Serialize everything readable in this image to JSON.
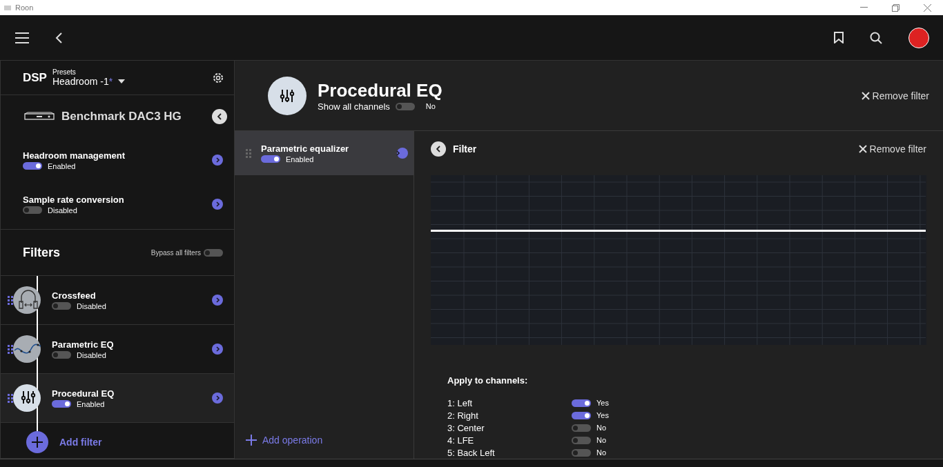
{
  "window": {
    "title": "Roon"
  },
  "dsp": {
    "title": "DSP",
    "presets_label": "Presets",
    "preset": "Headroom -1",
    "modified_mark": "*"
  },
  "device": {
    "name": "Benchmark DAC3 HG"
  },
  "settings": [
    {
      "title": "Headroom management",
      "enabled": true,
      "state": "Enabled"
    },
    {
      "title": "Sample rate conversion",
      "enabled": false,
      "state": "Disabled"
    }
  ],
  "filters": {
    "title": "Filters",
    "bypass_label": "Bypass all filters",
    "bypass": false,
    "items": [
      {
        "kind": "crossfeed",
        "name": "Crossfeed",
        "enabled": false,
        "state": "Disabled",
        "selected": false
      },
      {
        "kind": "parametric",
        "name": "Parametric EQ",
        "enabled": false,
        "state": "Disabled",
        "selected": false
      },
      {
        "kind": "procedural",
        "name": "Procedural EQ",
        "enabled": true,
        "state": "Enabled",
        "selected": true
      }
    ],
    "add_label": "Add filter"
  },
  "detail": {
    "title": "Procedural EQ",
    "show_all_label": "Show all channels",
    "show_all": false,
    "show_all_state": "No",
    "remove_label": "Remove filter"
  },
  "operations": {
    "items": [
      {
        "name": "Parametric equalizer",
        "enabled": true,
        "state": "Enabled",
        "selected": true
      }
    ],
    "add_label": "Add operation"
  },
  "filter_panel": {
    "title": "Filter",
    "remove_label": "Remove filter",
    "channels_title": "Apply to channels:",
    "channels": [
      {
        "name": "1: Left",
        "on": true,
        "state": "Yes"
      },
      {
        "name": "2: Right",
        "on": true,
        "state": "Yes"
      },
      {
        "name": "3: Center",
        "on": false,
        "state": "No"
      },
      {
        "name": "4: LFE",
        "on": false,
        "state": "No"
      },
      {
        "name": "5: Back Left",
        "on": false,
        "state": "No"
      }
    ]
  }
}
